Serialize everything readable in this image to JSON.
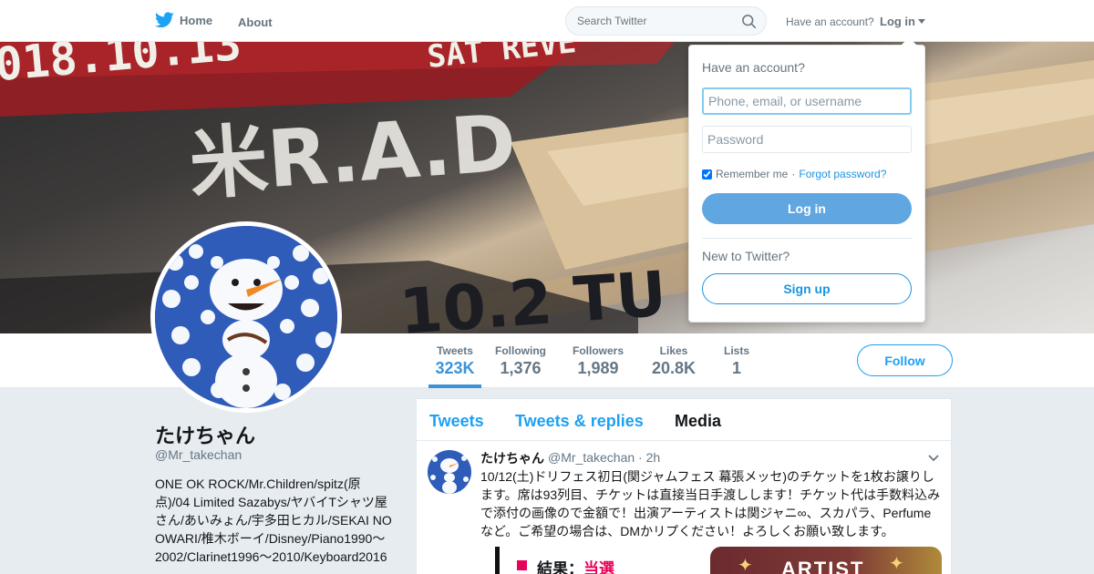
{
  "nav": {
    "home_label": "Home",
    "about_label": "About",
    "search_placeholder": "Search Twitter",
    "have_account": "Have an account?",
    "login_label": "Log in"
  },
  "banner": {
    "text_line1": "018.10.13",
    "text_line1b": "SAT REVE",
    "text_line2": "米R.A.D",
    "text_line3": "10.2 TU"
  },
  "profile": {
    "name": "たけちゃん",
    "handle": "@Mr_takechan",
    "bio": "ONE OK ROCK/Mr.Children/spitz(原点)/04 Limited Sazabys/ヤバイTシャツ屋さん/あいみょん/宇多田ヒカル/SEKAI NO OWARI/椎木ボーイ/Disney/Piano1990～2002/Clarinet1996～2010/Keyboard2016",
    "follow_label": "Follow"
  },
  "stats": [
    {
      "label": "Tweets",
      "value": "323K"
    },
    {
      "label": "Following",
      "value": "1,376"
    },
    {
      "label": "Followers",
      "value": "1,989"
    },
    {
      "label": "Likes",
      "value": "20.8K"
    },
    {
      "label": "Lists",
      "value": "1"
    }
  ],
  "tabs": [
    {
      "label": "Tweets"
    },
    {
      "label": "Tweets & replies"
    },
    {
      "label": "Media"
    }
  ],
  "tweet": {
    "name": "たけちゃん",
    "handle": "@Mr_takechan",
    "separator": "·",
    "time": "2h",
    "text": "10/12(土)ドリフェス初日(関ジャムフェス 幕張メッセ)のチケットを1枚お譲りします。席は93列目、チケットは直接当日手渡しします！チケット代は手数料込みで添付の画像ので金額で！出演アーティストは関ジャニ∞、スカパラ、Perfumeなど。ご希望の場合は、DMかリプください！よろしくお願い致します。",
    "media_left_label": "結果：",
    "media_left_value": "当選",
    "media_right_label": "ARTIST"
  },
  "login_dropdown": {
    "title": "Have an account?",
    "username_placeholder": "Phone, email, or username",
    "password_placeholder": "Password",
    "remember_label": "Remember me",
    "separator": "·",
    "forgot_label": "Forgot password?",
    "login_button": "Log in",
    "new_label": "New to Twitter?",
    "signup_button": "Sign up"
  },
  "colors": {
    "brand_blue": "#1da1f2",
    "link_blue": "#1b95e0",
    "login_button": "#60a6e1",
    "background": "#e6ecf0"
  },
  "icons": [
    "twitter-bird-icon",
    "search-icon",
    "caret-down-icon",
    "chevron-down-icon"
  ]
}
